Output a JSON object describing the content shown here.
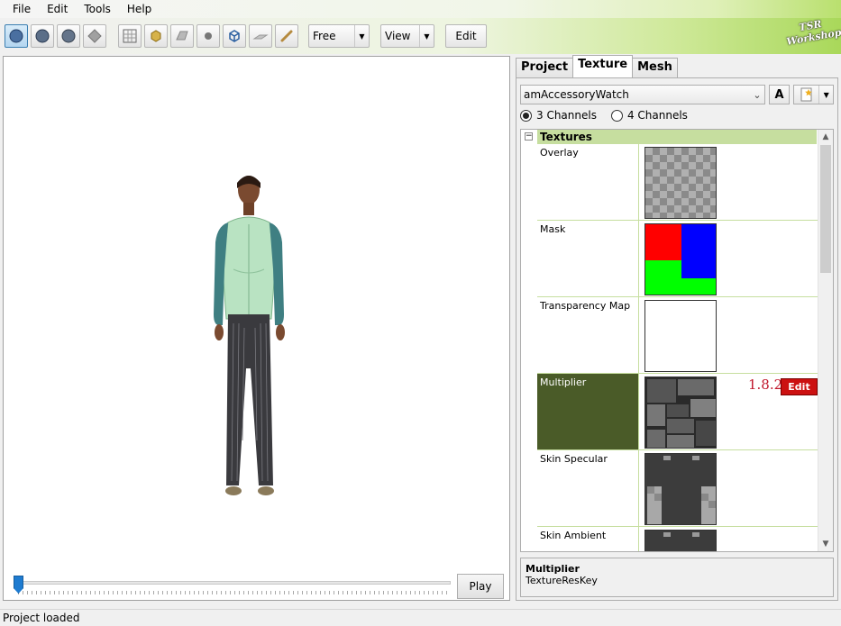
{
  "menu": [
    "File",
    "Edit",
    "Tools",
    "Help"
  ],
  "toolbar": {
    "free_label": "Free",
    "view_label": "View",
    "edit_label": "Edit"
  },
  "logo_text": [
    "TSR",
    "Workshop"
  ],
  "viewport": {
    "play_label": "Play",
    "timeline_position": 0.0
  },
  "tabs": [
    {
      "label": "Project",
      "active": false
    },
    {
      "label": "Texture",
      "active": true
    },
    {
      "label": "Mesh",
      "active": false
    }
  ],
  "texture_panel": {
    "selected_item": "amAccessoryWatch",
    "channels": [
      {
        "label": "3 Channels",
        "checked": true
      },
      {
        "label": "4 Channels",
        "checked": false
      }
    ],
    "category": "Textures",
    "rows": [
      {
        "name": "Overlay",
        "thumb": "checker"
      },
      {
        "name": "Mask",
        "thumb": "mask"
      },
      {
        "name": "Transparency Map",
        "thumb": "white"
      },
      {
        "name": "Multiplier",
        "thumb": "multiplier",
        "selected": true,
        "version": "1.8.2",
        "edit_label": "Edit"
      },
      {
        "name": "Skin Specular",
        "thumb": "specular"
      },
      {
        "name": "Skin Ambient",
        "thumb": "ambient"
      }
    ],
    "description": {
      "title": "Multiplier",
      "subtitle": "TextureResKey"
    }
  },
  "status": "Project loaded",
  "colors": {
    "category_bg": "#c6de9f",
    "selected_row": "#4a5b28",
    "edit_button": "#cc1111",
    "version_text": "#c0162b"
  }
}
